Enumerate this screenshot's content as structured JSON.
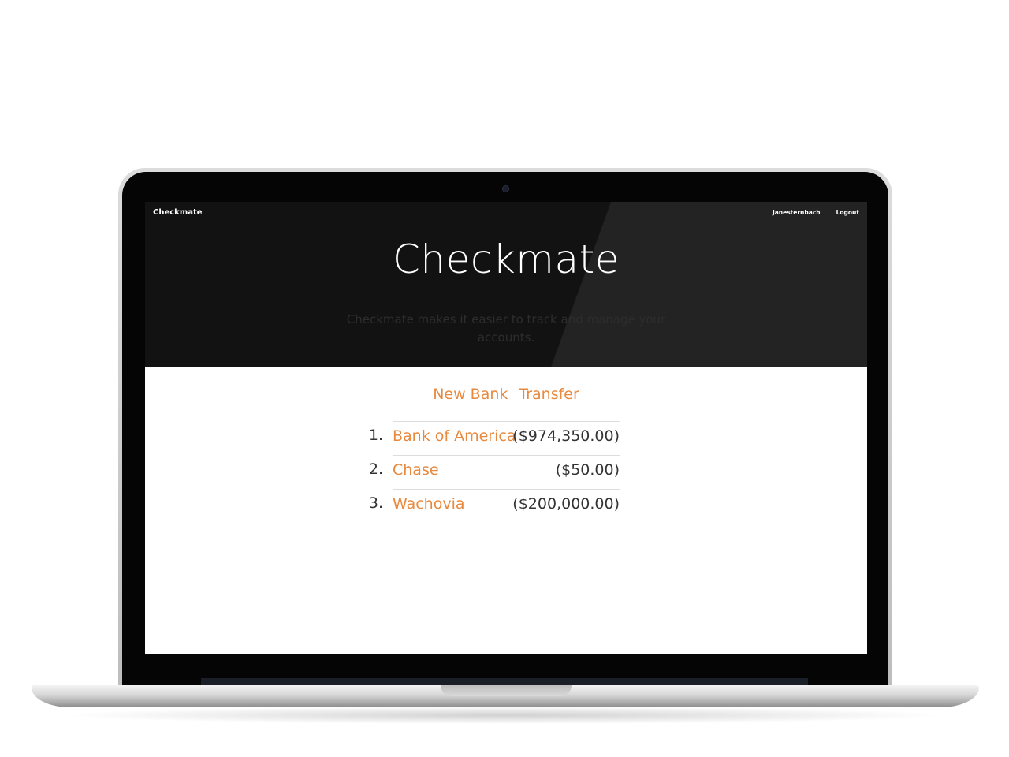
{
  "nav": {
    "brand": "Checkmate",
    "username": "Janesternbach",
    "logout": "Logout"
  },
  "hero": {
    "title": "Checkmate",
    "subtitle": "Checkmate makes it easier to track and manage your accounts."
  },
  "actions": {
    "new_bank": "New Bank",
    "transfer": "Transfer"
  },
  "accounts": [
    {
      "num": "1.",
      "name": "Bank of America",
      "amount": "($974,350.00)"
    },
    {
      "num": "2.",
      "name": "Chase",
      "amount": "($50.00)"
    },
    {
      "num": "3.",
      "name": "Wachovia",
      "amount": "($200,000.00)"
    }
  ],
  "colors": {
    "accent": "#e8893e",
    "hero_bg": "#121212",
    "text": "#333333"
  }
}
